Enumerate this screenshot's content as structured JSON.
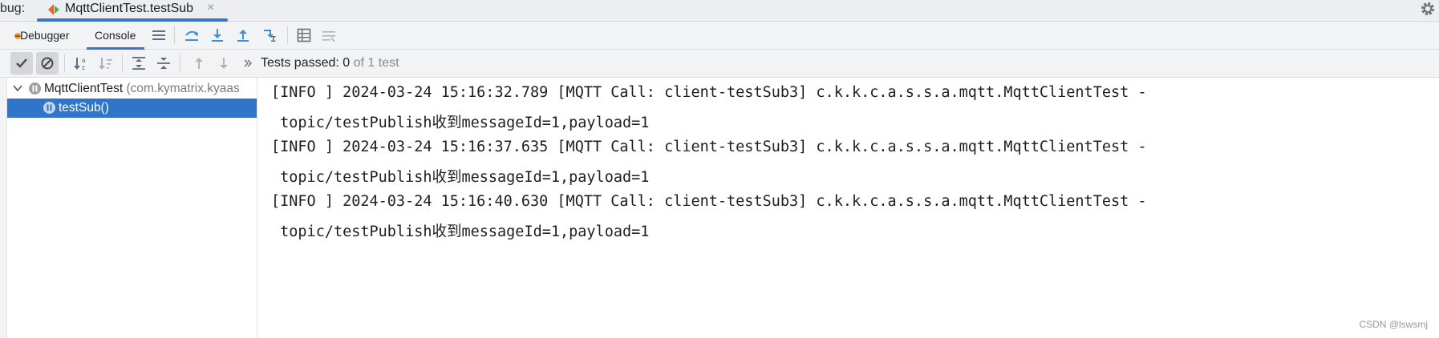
{
  "tabbar": {
    "window_label": "bug:",
    "tab_title": "MqttClientTest.testSub",
    "close_glyph": "×"
  },
  "toolbar": {
    "debugger_label": "Debugger",
    "console_label": "Console"
  },
  "test_status": {
    "prefix": "Tests passed: ",
    "count": "0",
    "total": " of 1 test"
  },
  "tree": {
    "items": [
      {
        "name": "MqttClientTest",
        "package": " (com.kymatrix.kyaas",
        "status_icon": "paused-icon",
        "expanded": true
      },
      {
        "name": "testSub()",
        "status_icon": "paused-icon",
        "selected": true
      }
    ]
  },
  "console": {
    "lines": [
      "[INFO ] 2024-03-24 15:16:32.789 [MQTT Call: client-testSub3] c.k.k.c.a.s.s.a.mqtt.MqttClientTest -",
      " topic/testPublish收到messageId=1,payload=1",
      "[INFO ] 2024-03-24 15:16:37.635 [MQTT Call: client-testSub3] c.k.k.c.a.s.s.a.mqtt.MqttClientTest -",
      " topic/testPublish收到messageId=1,payload=1",
      "[INFO ] 2024-03-24 15:16:40.630 [MQTT Call: client-testSub3] c.k.k.c.a.s.s.a.mqtt.MqttClientTest -",
      " topic/testPublish收到messageId=1,payload=1"
    ]
  },
  "watermark": "CSDN @lswsmj",
  "colors": {
    "accent": "#3874c8",
    "selection": "#2f75c9",
    "icon_blue": "#3d8fd6",
    "icon_gray": "#6e6e6e",
    "status_paused": "#9aa0a6"
  }
}
